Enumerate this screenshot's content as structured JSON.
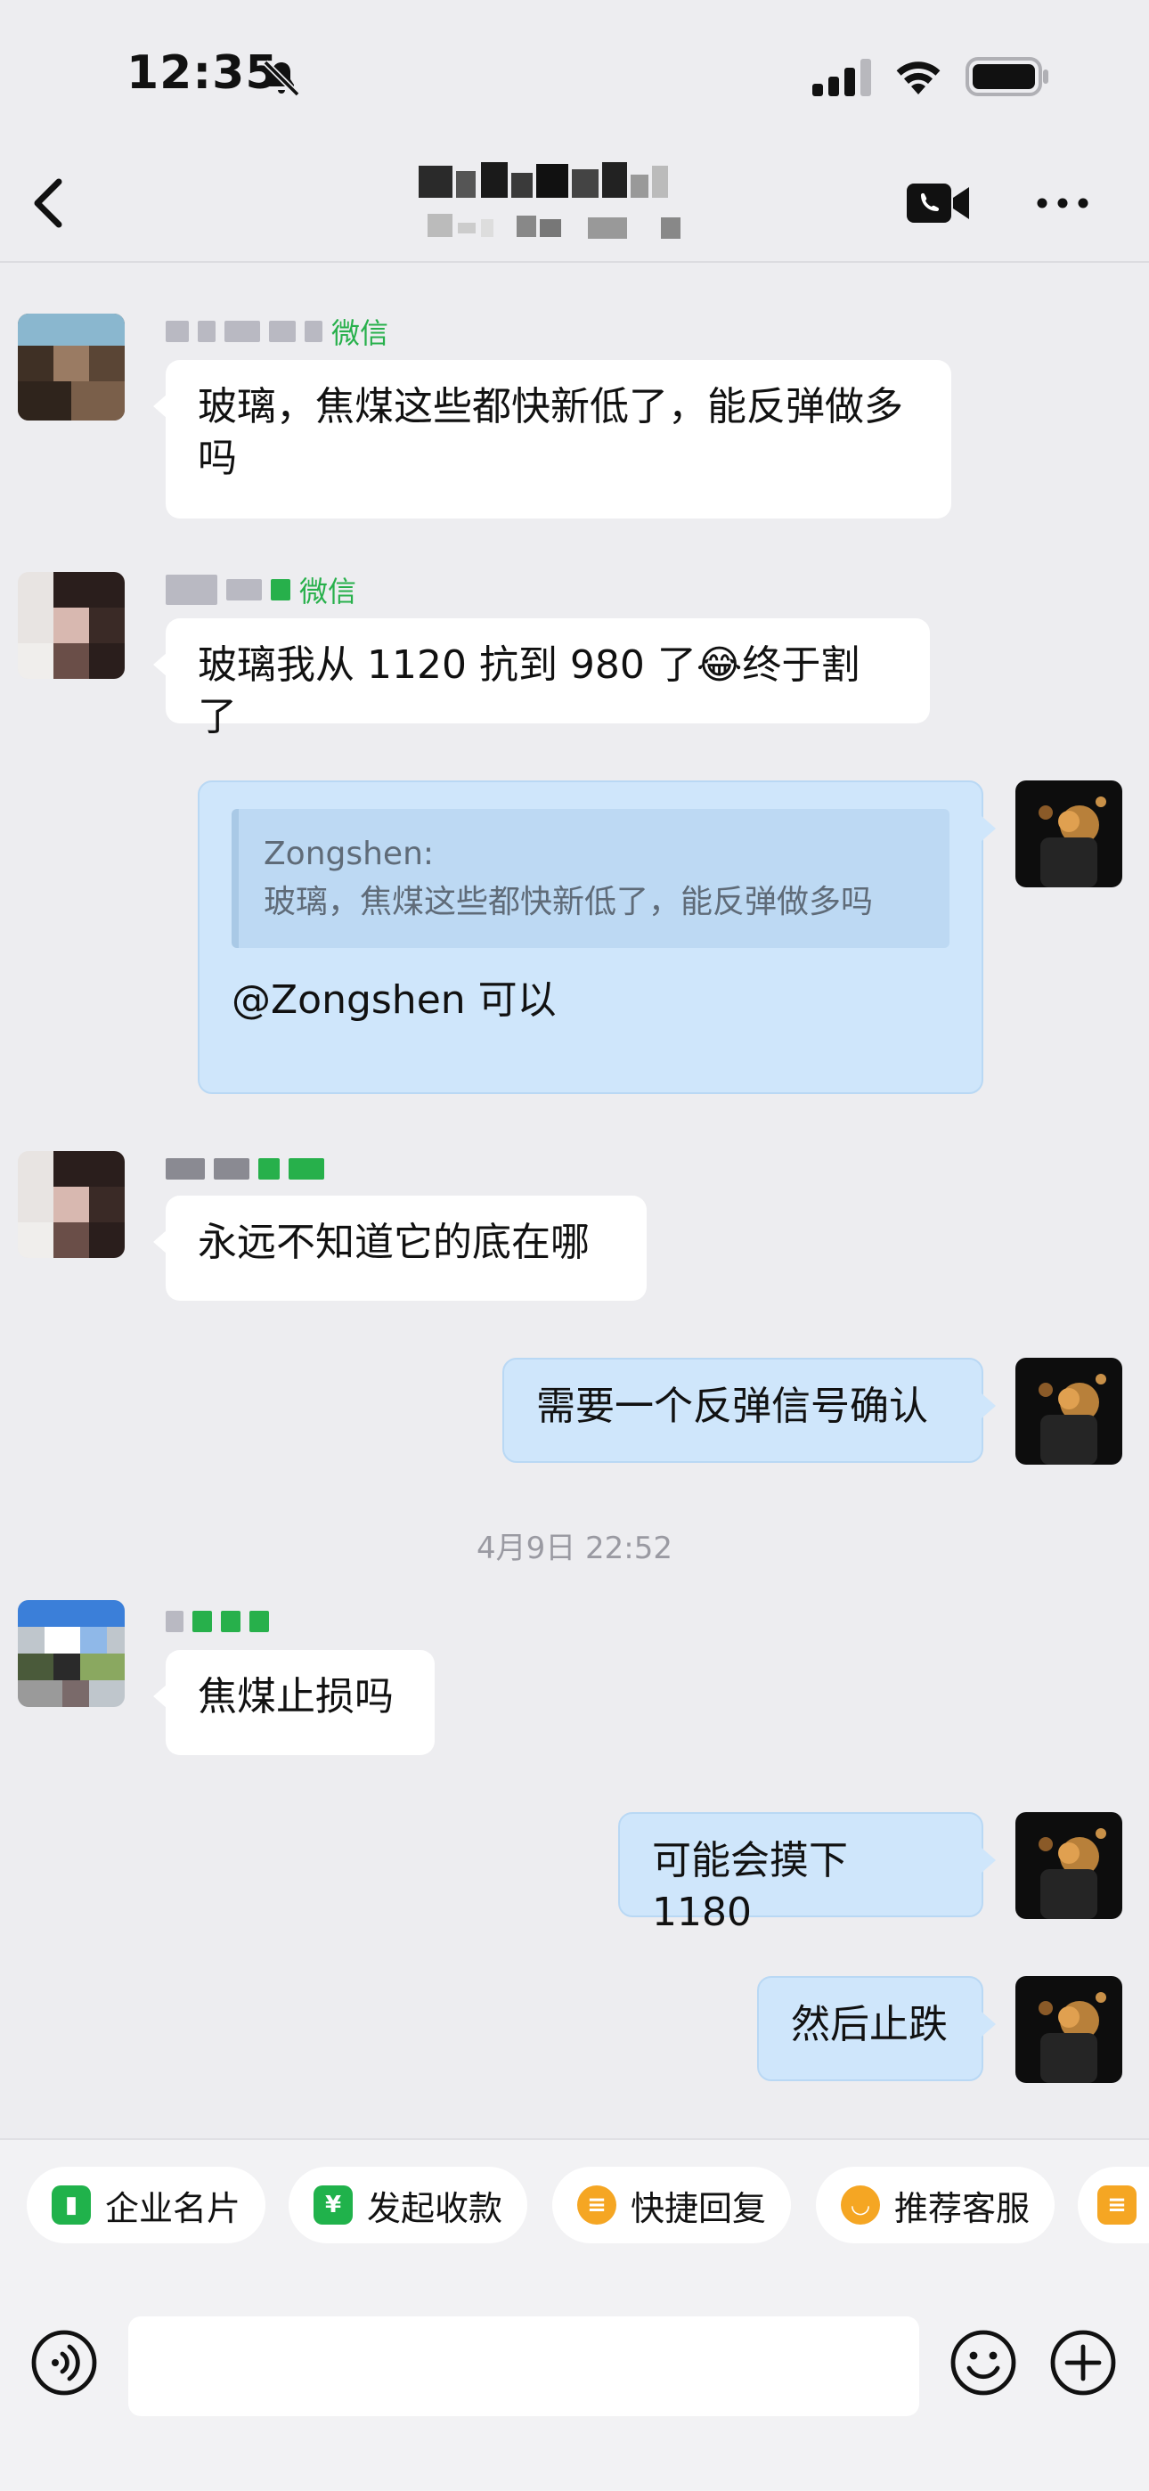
{
  "status_bar": {
    "time": "12:35"
  },
  "messages": [
    {
      "side": "left",
      "source": "微信",
      "text": "玻璃，焦煤这些都快新低了，能反弹做多吗"
    },
    {
      "side": "left",
      "source": "微信",
      "text": "玻璃我从 1120 抗到 980 了😂终于割了"
    },
    {
      "side": "right",
      "quote_author": "Zongshen:",
      "quote_text": "玻璃，焦煤这些都快新低了，能反弹做多吗",
      "text": "@Zongshen 可以"
    },
    {
      "side": "left",
      "text": "永远不知道它的底在哪"
    },
    {
      "side": "right",
      "text": "需要一个反弹信号确认"
    },
    {
      "side": "left",
      "text": "焦煤止损吗"
    },
    {
      "side": "right",
      "text": "可能会摸下 1180"
    },
    {
      "side": "right",
      "text": "然后止跌"
    }
  ],
  "timestamp": "4月9日 22:52",
  "quick_actions": [
    {
      "label": "企业名片",
      "color": "#20b24b"
    },
    {
      "label": "发起收款",
      "color": "#20b24b"
    },
    {
      "label": "快捷回复",
      "color": "#f5a623"
    },
    {
      "label": "推荐客服",
      "color": "#f5a623"
    }
  ]
}
